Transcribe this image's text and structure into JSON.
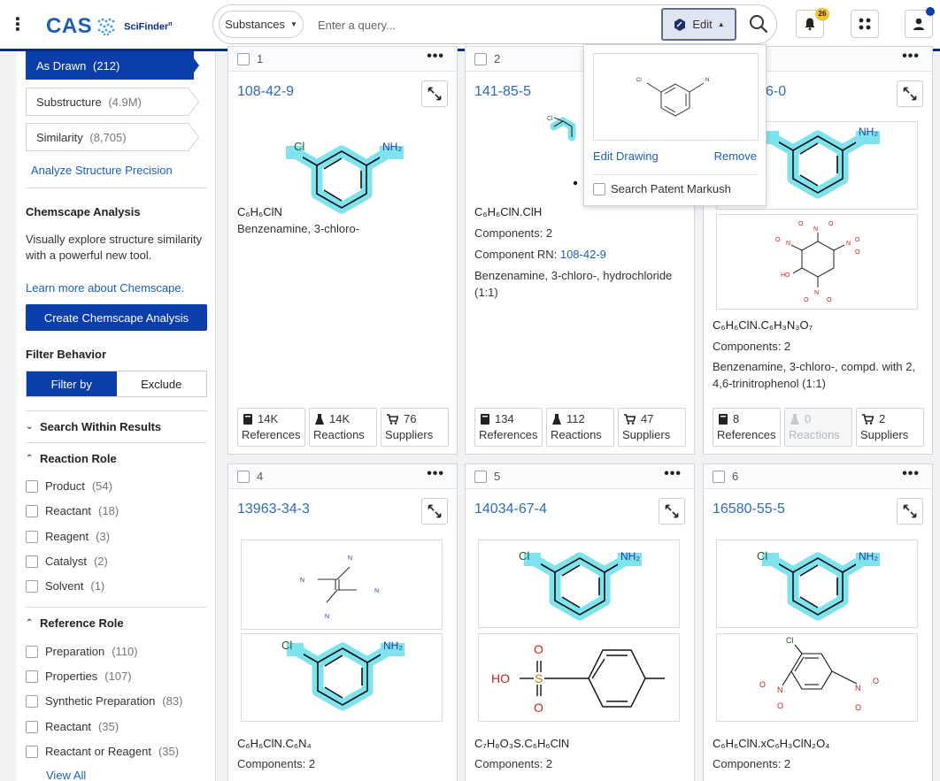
{
  "header": {
    "logo_text": "CAS",
    "product_name": "SciFinder",
    "product_sup": "n",
    "search_type": "Substances",
    "query_placeholder": "Enter a query...",
    "edit_label": "Edit",
    "notification_count": "26"
  },
  "sidebar": {
    "steps": [
      {
        "label": "As Drawn",
        "count": "(212)"
      },
      {
        "label": "Substructure",
        "count": "(4.9M)"
      },
      {
        "label": "Similarity",
        "count": "(8,705)"
      }
    ],
    "analyze_link": "Analyze Structure Precision",
    "chemscape": {
      "title": "Chemscape Analysis",
      "description": "Visually explore structure similarity with a powerful new tool.",
      "learn_more": "Learn more about Chemscape.",
      "button": "Create Chemscape Analysis"
    },
    "filter_behavior": {
      "title": "Filter Behavior",
      "filter_by": "Filter by",
      "exclude": "Exclude"
    },
    "search_within": "Search Within Results",
    "reaction_role": {
      "title": "Reaction Role",
      "items": [
        {
          "label": "Product",
          "count": "(54)"
        },
        {
          "label": "Reactant",
          "count": "(18)"
        },
        {
          "label": "Reagent",
          "count": "(3)"
        },
        {
          "label": "Catalyst",
          "count": "(2)"
        },
        {
          "label": "Solvent",
          "count": "(1)"
        }
      ]
    },
    "reference_role": {
      "title": "Reference Role",
      "items": [
        {
          "label": "Preparation",
          "count": "(110)"
        },
        {
          "label": "Properties",
          "count": "(107)"
        },
        {
          "label": "Synthetic Preparation",
          "count": "(83)"
        },
        {
          "label": "Reactant",
          "count": "(35)"
        },
        {
          "label": "Reactant or Reagent",
          "count": "(35)"
        }
      ],
      "view_all": "View All"
    }
  },
  "popup": {
    "edit_drawing": "Edit Drawing",
    "remove": "Remove",
    "patent_markush": "Search Patent Markush"
  },
  "cards": [
    {
      "num": "1",
      "rn": "108-42-9",
      "formula_html": "C₆H₆ClN",
      "name": "Benzenamine, 3-chloro-",
      "stats": [
        {
          "value": "14K",
          "label": "References"
        },
        {
          "value": "14K",
          "label": "Reactions"
        },
        {
          "value": "76",
          "label": "Suppliers"
        }
      ]
    },
    {
      "num": "2",
      "rn": "141-85-5",
      "formula_html": "C₆H₆ClN.ClH",
      "components": "Components: 2",
      "component_rn_label": "Component RN:",
      "component_rn": "108-42-9",
      "name": "Benzenamine, 3-chloro-, hydrochloride (1:1)",
      "stats": [
        {
          "value": "134",
          "label": "References"
        },
        {
          "value": "112",
          "label": "Reactions"
        },
        {
          "value": "47",
          "label": "Suppliers"
        }
      ]
    },
    {
      "num": "3",
      "rn": "6-0",
      "formula_html": "C₆H₆ClN.C₆H₃N₃O₇",
      "components": "Components: 2",
      "name": "Benzenamine, 3-chloro-, compd. with 2, 4,6-trinitrophenol (1:1)",
      "stats": [
        {
          "value": "8",
          "label": "References"
        },
        {
          "value": "0",
          "label": "Reactions"
        },
        {
          "value": "2",
          "label": "Suppliers"
        }
      ]
    },
    {
      "num": "4",
      "rn": "13963-34-3",
      "formula_html": "C₆H₆ClN.C₆N₄",
      "components": "Components: 2"
    },
    {
      "num": "5",
      "rn": "14034-67-4",
      "formula_html": "C₇H₈O₃S.C₆H₆ClN",
      "components": "Components: 2"
    },
    {
      "num": "6",
      "rn": "16580-55-5",
      "formula_html": "C₆H₆ClN.xC₆H₃ClN₂O₄",
      "components": "Components: 2"
    }
  ],
  "atoms": {
    "cl": "Cl",
    "nh2": "NH₂",
    "n": "N",
    "oh": "OH",
    "ho": "HO",
    "o": "O",
    "s": "S"
  }
}
